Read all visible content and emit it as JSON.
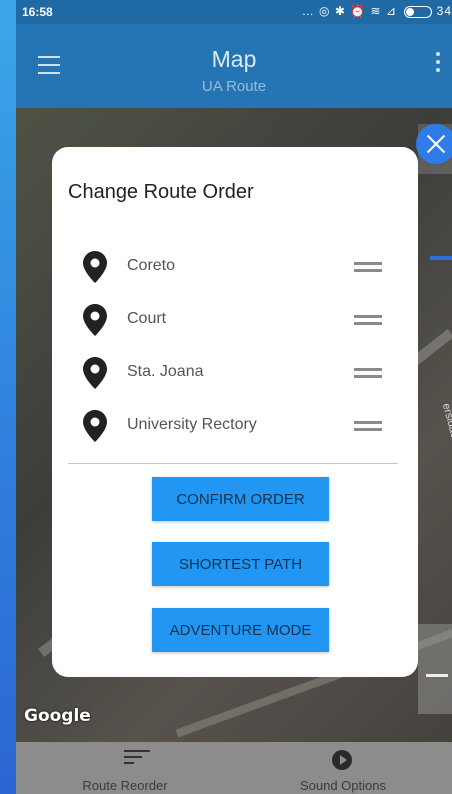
{
  "status_bar": {
    "time": "16:58",
    "icons_text": "… ◎ ✱ ⏰ ≋ ⊿",
    "battery": "34"
  },
  "toolbar": {
    "title": "Map",
    "subtitle": "UA Route"
  },
  "map": {
    "attribution": "Google",
    "street_label": "ersidade"
  },
  "dialog": {
    "title": "Change Route Order",
    "stops": [
      {
        "name": "Coreto"
      },
      {
        "name": "Court"
      },
      {
        "name": "Sta. Joana"
      },
      {
        "name": "University Rectory"
      }
    ],
    "buttons": {
      "confirm": "CONFIRM ORDER",
      "shortest": "SHORTEST PATH",
      "adventure": "ADVENTURE MODE"
    }
  },
  "bottom_nav": {
    "items": [
      {
        "label": "Route Reorder",
        "icon": "sort-icon"
      },
      {
        "label": "Sound Options",
        "icon": "play-circle-icon"
      }
    ]
  },
  "colors": {
    "primary": "#2574b3",
    "accent": "#2196f3",
    "close": "#2f7be8"
  }
}
